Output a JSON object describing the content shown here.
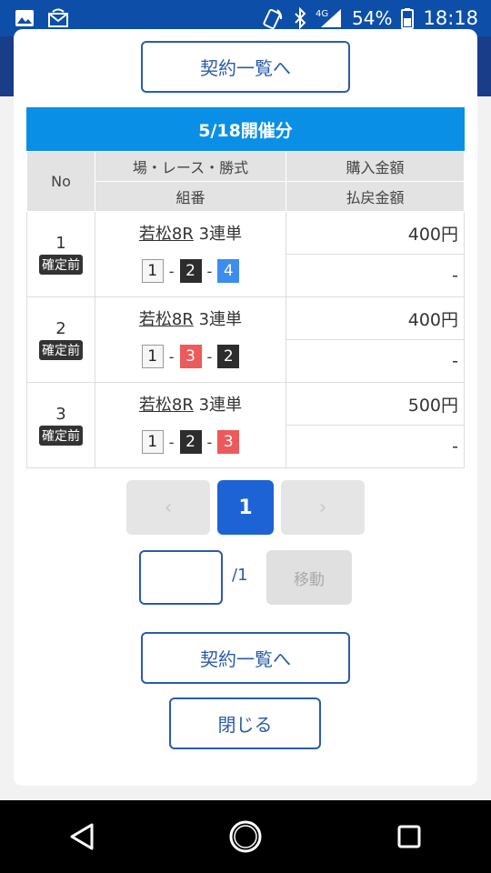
{
  "status_bar": {
    "battery": "54%",
    "time": "18:18",
    "network": "4G",
    "icons": [
      "image-icon",
      "sim-icon",
      "nfc-icon",
      "bluetooth-icon",
      "signal-icon",
      "battery-icon"
    ]
  },
  "modal": {
    "top_button": "契約一覧へ",
    "date_header": "5/18開催分",
    "table": {
      "headers": {
        "no": "No",
        "race": "場・レース・勝式",
        "purchase": "購入金額",
        "combo": "組番",
        "payout": "払戻金額"
      },
      "rows": [
        {
          "no": "1",
          "status": "確定前",
          "place": "若松8R",
          "type": "3連単",
          "combo": [
            {
              "n": "1",
              "c": "white"
            },
            {
              "n": "2",
              "c": "black"
            },
            {
              "n": "4",
              "c": "blue"
            }
          ],
          "purchase": "400円",
          "payout": "-"
        },
        {
          "no": "2",
          "status": "確定前",
          "place": "若松8R",
          "type": "3連単",
          "combo": [
            {
              "n": "1",
              "c": "white"
            },
            {
              "n": "3",
              "c": "red"
            },
            {
              "n": "2",
              "c": "black"
            }
          ],
          "purchase": "400円",
          "payout": "-"
        },
        {
          "no": "3",
          "status": "確定前",
          "place": "若松8R",
          "type": "3連単",
          "combo": [
            {
              "n": "1",
              "c": "white"
            },
            {
              "n": "2",
              "c": "black"
            },
            {
              "n": "3",
              "c": "red"
            }
          ],
          "purchase": "500円",
          "payout": "-"
        }
      ]
    },
    "pagination": {
      "prev": "‹",
      "current": "1",
      "next": "›",
      "total": "/1",
      "input_value": "",
      "move": "移動"
    },
    "bottom_button": "契約一覧へ",
    "close_button": "閉じる"
  },
  "colors": {
    "accent": "#2a5cab",
    "header_blue": "#0a8fe6",
    "active_page": "#1d63d6"
  }
}
